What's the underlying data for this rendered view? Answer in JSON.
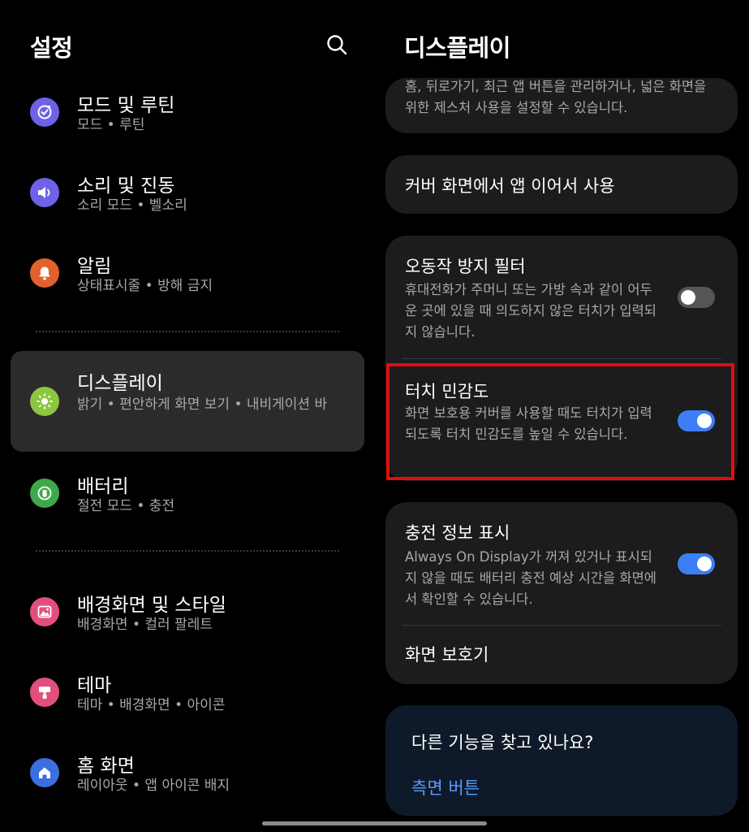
{
  "left": {
    "title": "설정",
    "search_icon": "search-icon",
    "items": [
      {
        "title": "모드 및 루틴",
        "sub": "모드 • 루틴",
        "icon": "routine-icon",
        "color": "#6e62e8"
      },
      {
        "title": "소리 및 진동",
        "sub": "소리 모드 • 벨소리",
        "icon": "volume-icon",
        "color": "#6e62e8"
      },
      {
        "title": "알림",
        "sub": "상태표시줄 • 방해 금지",
        "icon": "bell-icon",
        "color": "#e2612d"
      },
      {
        "title": "디스플레이",
        "sub": "밝기 • 편안하게 화면 보기 • 내비게이션 바",
        "icon": "sun-icon",
        "color": "#8cc63e"
      },
      {
        "title": "배터리",
        "sub": "절전 모드 • 충전",
        "icon": "battery-icon",
        "color": "#3ea84a"
      },
      {
        "title": "배경화면 및 스타일",
        "sub": "배경화면 • 컬러 팔레트",
        "icon": "image-icon",
        "color": "#e34f7d"
      },
      {
        "title": "테마",
        "sub": "테마 • 배경화면 • 아이콘",
        "icon": "theme-brush-icon",
        "color": "#e34f7d"
      },
      {
        "title": "홈 화면",
        "sub": "레이아웃 • 앱 아이콘 배지",
        "icon": "home-icon",
        "color": "#3b6fe0"
      }
    ]
  },
  "right": {
    "title": "디스플레이",
    "card1_desc": "홈, 뒤로가기, 최근 앱 버튼을 관리하거나, 넓은 화면을 위한 제스처 사용을 설정할 수 있습니다.",
    "cover_continue": "커버 화면에서 앱 이어서 사용",
    "accidental_title": "오동작 방지 필터",
    "accidental_desc": "휴대전화가 주머니 또는 가방 속과 같이 어두운 곳에 있을 때 의도하지 않은 터치가 입력되지 않습니다.",
    "accidental_on": false,
    "touch_title": "터치 민감도",
    "touch_desc": "화면 보호용 커버를 사용할 때도 터치가 입력되도록 터치 민감도를 높일 수 있습니다.",
    "touch_on": true,
    "charging_title": "충전 정보 표시",
    "charging_desc": "Always On Display가 꺼져 있거나 표시되지 않을 때도 배터리 충전 예상 시간을 화면에서 확인할 수 있습니다.",
    "charging_on": true,
    "screensaver": "화면 보호기",
    "looking_title": "다른 기능을 찾고 있나요?",
    "side_button_link": "측면 버튼"
  },
  "colors": {
    "accent_blue": "#3c7ef5",
    "highlight_red": "#e00e0e",
    "link_blue": "#5a9bff"
  }
}
